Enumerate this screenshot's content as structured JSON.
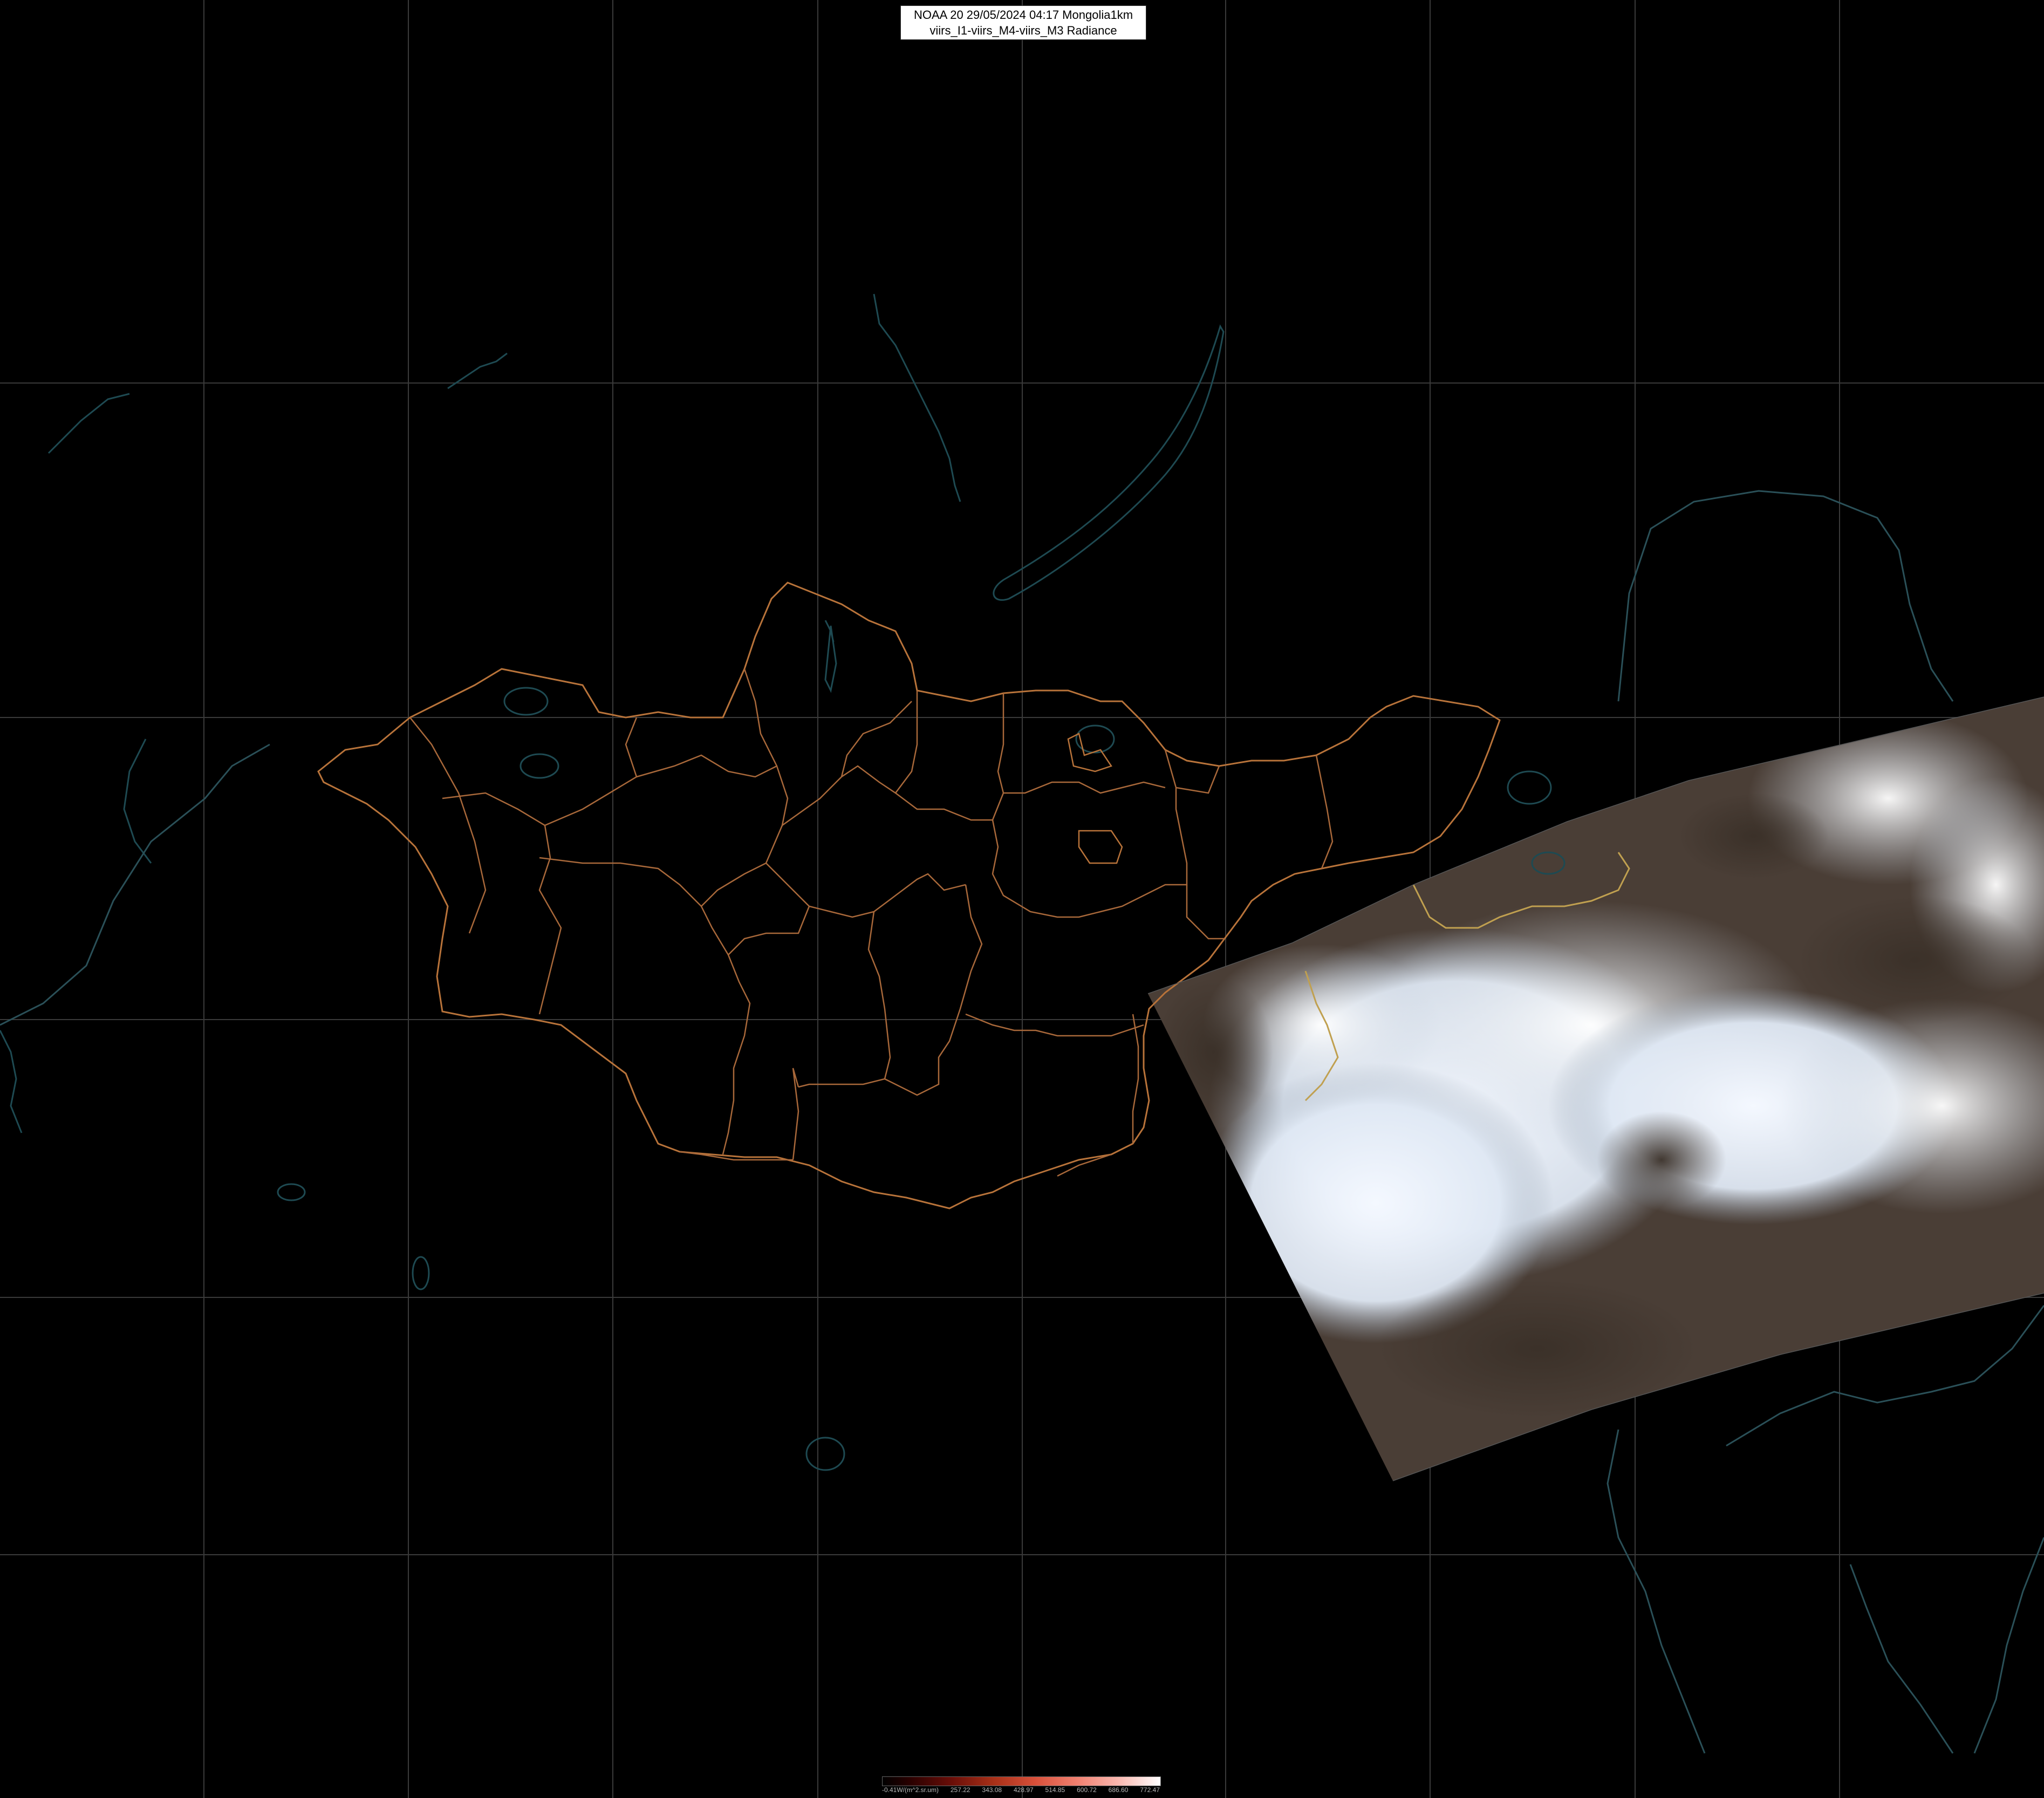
{
  "header": {
    "line1": "NOAA 20 29/05/2024 04:17 Mongolia1km",
    "line2": "viirs_I1-viirs_M4-viirs_M3 Radiance"
  },
  "colorbar": {
    "unit_label": "-0.41W/(m^2.sr.um)",
    "ticks": [
      "257.22",
      "343.08",
      "428.97",
      "514.85",
      "600.72",
      "686.60",
      "772.47"
    ]
  },
  "colors": {
    "background": "#000000",
    "graticule": "#3a3a3a",
    "admin_borders": "#b8733a",
    "water_features": "#1e4a52",
    "cloud": "#e8f0fa",
    "land_in_swath": "#4a3e36"
  }
}
